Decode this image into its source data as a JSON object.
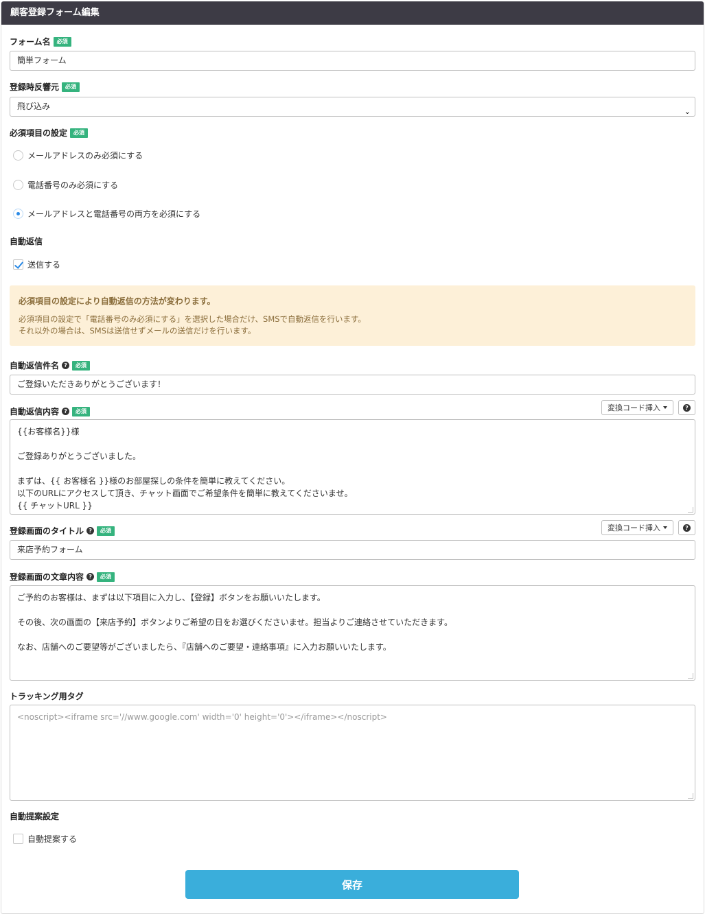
{
  "header": {
    "title": "顧客登録フォーム編集"
  },
  "required_badge": "必須",
  "form_name": {
    "label": "フォーム名",
    "value": "簡単フォーム"
  },
  "source": {
    "label": "登録時反響元",
    "value": "飛び込み"
  },
  "required_settings": {
    "label": "必須項目の設定",
    "options": [
      {
        "label": "メールアドレスのみ必須にする",
        "selected": false
      },
      {
        "label": "電話番号のみ必須にする",
        "selected": false
      },
      {
        "label": "メールアドレスと電話番号の両方を必須にする",
        "selected": true
      }
    ]
  },
  "auto_reply": {
    "label": "自動返信",
    "checkbox_label": "送信する",
    "checked": true
  },
  "notice": {
    "title": "必須項目の設定により自動返信の方法が変わります。",
    "line1": "必須項目の設定で「電話番号のみ必須にする」を選択した場合だけ、SMSで自動返信を行います。",
    "line2": "それ以外の場合は、SMSは送信せずメールの送信だけを行います。"
  },
  "reply_subject": {
    "label": "自動返信件名",
    "value": "ご登録いただきありがとうございます！"
  },
  "reply_body": {
    "label": "自動返信内容",
    "insert_code_button": "変換コード挿入",
    "lines": [
      "{{お客様名}}様",
      "",
      "ご登録ありがとうございました。",
      "",
      "まずは、{{ お客様名 }}様のお部屋探しの条件を簡単に教えてください。",
      "以下のURLにアクセスして頂き、チャット画面でご希望条件を簡単に教えてくださいませ。",
      "{{ チャットURL }}"
    ]
  },
  "page_title": {
    "label": "登録画面のタイトル",
    "insert_code_button": "変換コード挿入",
    "value": "来店予約フォーム"
  },
  "page_text": {
    "label": "登録画面の文章内容",
    "lines": [
      "ご予約のお客様は、まずは以下項目に入力し、【登録】ボタンをお願いいたします。",
      "",
      "その後、次の画面の【来店予約】ボタンよりご希望の日をお選びくださいませ。担当よりご連絡させていただきます。",
      "",
      "なお、店舗へのご要望等がございましたら、『店舗へのご要望・連絡事項』に入力お願いいたします。"
    ]
  },
  "tracking_tag": {
    "label": "トラッキング用タグ",
    "placeholder": "<noscript><iframe src='//www.google.com' width='0' height='0'></iframe></noscript>"
  },
  "auto_suggest": {
    "label": "自動提案設定",
    "checkbox_label": "自動提案する",
    "checked": false
  },
  "save_button": "保存",
  "colors": {
    "header_bg": "#3d3b45",
    "required_badge": "#35b37e",
    "accent": "#2a8ae6",
    "save_bg": "#3aaedb",
    "notice_bg": "#fdf0d8",
    "notice_text": "#8a6d3b"
  }
}
